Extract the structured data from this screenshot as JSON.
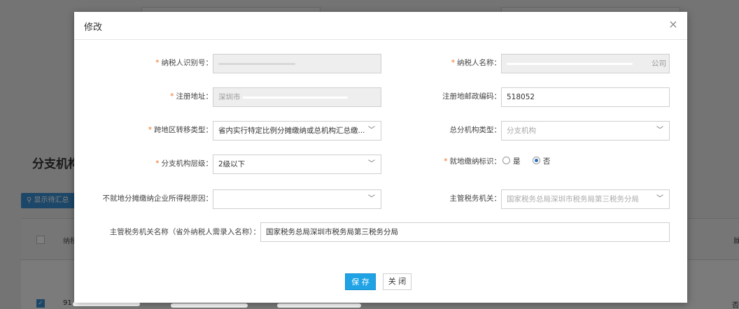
{
  "background": {
    "section_title": "分支机构",
    "show_button_label": "显示待汇总",
    "table_col_label": "纳税",
    "row_id_prefix": "91",
    "right_col_text": "否",
    "right_head_text": "就"
  },
  "modal": {
    "title": "修改",
    "close_icon": "×",
    "fields": {
      "taxpayer_id": {
        "label": "纳税人识别号：",
        "required": true
      },
      "taxpayer_name": {
        "label": "纳税人名称：",
        "required": true,
        "value_start": "",
        "value_end": "公司"
      },
      "reg_address": {
        "label": "注册地址：",
        "required": true,
        "value": "深圳市"
      },
      "reg_postcode": {
        "label": "注册地邮政编码：",
        "required": false,
        "value": "518052"
      },
      "cross_region_type": {
        "label": "跨地区转移类型：",
        "required": true,
        "value": "省内实行特定比例分摊缴纳或总机构汇总缴..."
      },
      "branch_type": {
        "label": "总分机构类型：",
        "required": false,
        "value": "分支机构"
      },
      "branch_level": {
        "label": "分支机构层级：",
        "required": true,
        "value": "2级以下"
      },
      "local_pay_flag": {
        "label": "就地缴纳标识：",
        "required": true,
        "options": [
          "是",
          "否"
        ],
        "selected": "否"
      },
      "non_local_reason": {
        "label": "不就地分摊缴纳企业所得税原因：",
        "required": false,
        "value": ""
      },
      "tax_authority": {
        "label": "主管税务机关：",
        "required": false,
        "value": "国家税务总局深圳市税务局第三税务分局"
      },
      "tax_authority_name": {
        "label": "主管税务机关名称（省外纳税人需录入名称）：",
        "required": false,
        "value": "国家税务总局深圳市税务局第三税务分局"
      }
    },
    "buttons": {
      "save": "保 存",
      "close": "关 闭"
    }
  },
  "colors": {
    "primary": "#1fa3e5",
    "required": "#f07020",
    "radio_checked": "#2a6fb8"
  }
}
